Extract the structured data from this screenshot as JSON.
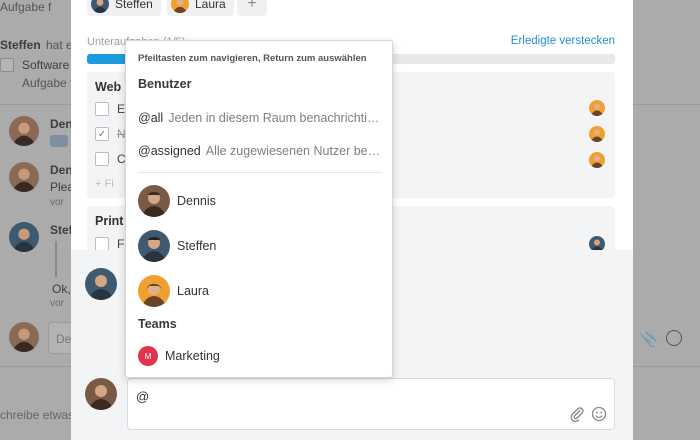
{
  "background": {
    "top_line": "Aufgabe f",
    "activity_user": "Steffen",
    "activity_rest": "hat e",
    "software_label": "Software",
    "aufgabe_label": "Aufgabe f",
    "feed": [
      {
        "name": "Den",
        "line2": ""
      },
      {
        "name": "Den",
        "line2": "Plea",
        "meta": "vor"
      },
      {
        "name": "Stef",
        "line2": "Ok,",
        "meta": "vor"
      }
    ],
    "comment_placeholder": "De",
    "write_placeholder": "chreibe etwas"
  },
  "modal": {
    "chips": [
      "Steffen",
      "Laura"
    ],
    "add_chip": "+",
    "subtasks_label": "Unteraufgaben (1/5)",
    "hide_done_link": "Erledigte verstecken",
    "progress_fraction": 0.2,
    "groups": [
      {
        "title": "Web",
        "tasks": [
          {
            "label": "Ev",
            "done": false
          },
          {
            "label": "N",
            "done": true
          },
          {
            "label": "C",
            "done": false
          }
        ],
        "add_hint": "+ Fi"
      },
      {
        "title": "Print",
        "tasks": [
          {
            "label": "Fl",
            "done": false
          }
        ]
      }
    ],
    "composer_text": "@"
  },
  "mention_dropdown": {
    "hint": "Pfeiltasten zum navigieren, Return zum auswählen",
    "users_section": "Benutzer",
    "special": [
      {
        "handle": "@all",
        "description": "Jeden in diesem Raum benachrichtigen"
      },
      {
        "handle": "@assigned",
        "description": "Alle zugewiesenen Nutzer benachrichtigen"
      }
    ],
    "users": [
      "Dennis",
      "Steffen",
      "Laura"
    ],
    "teams_section": "Teams",
    "teams": [
      {
        "name": "Marketing",
        "initial": "M",
        "color": "#e0344a"
      }
    ]
  },
  "colors": {
    "accent": "#1e9be0",
    "link": "#1f8fd6"
  }
}
